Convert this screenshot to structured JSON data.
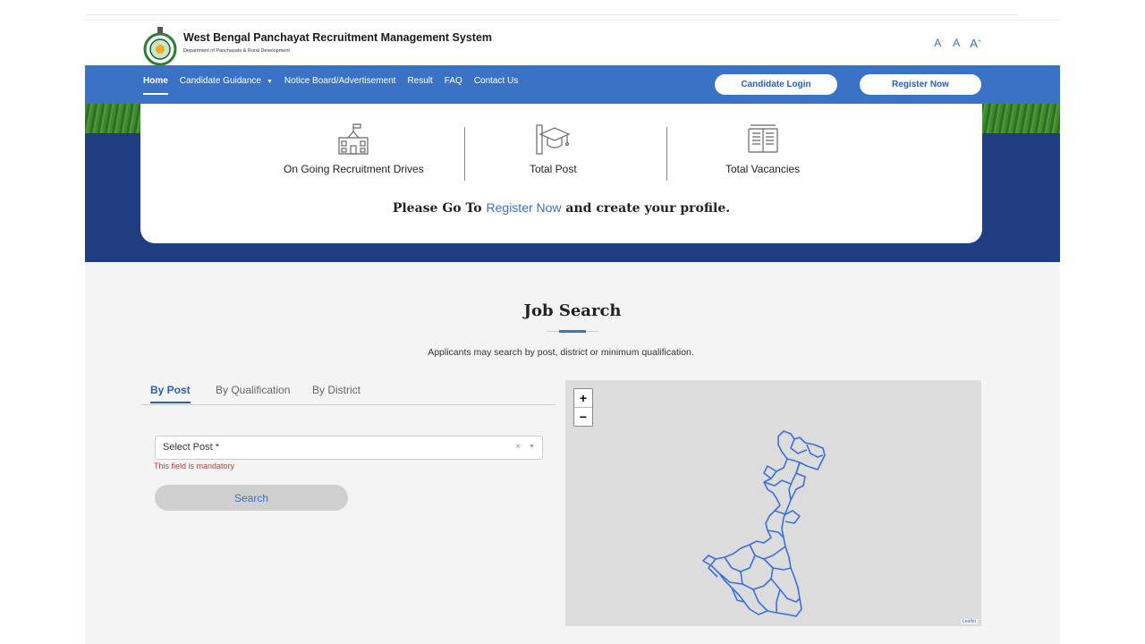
{
  "header": {
    "title": "West Bengal Panchayat Recruitment Management System",
    "subtitle": "Department of Panchayats & Rural Development",
    "font_small": "A",
    "font_normal": "A",
    "font_large": "A",
    "font_small_sup": "-",
    "font_large_sup": "+"
  },
  "nav": {
    "home": "Home",
    "candidate_guidance": "Candidate Guidance",
    "notice_board": "Notice Board/Advertisement",
    "result": "Result",
    "faq": "FAQ",
    "contact": "Contact Us",
    "login": "Candidate Login",
    "register": "Register Now"
  },
  "stats": {
    "drives": "On Going Recruitment Drives",
    "posts": "Total Post",
    "vacancies": "Total Vacancies"
  },
  "cta": {
    "prefix": "Please Go To",
    "link": "Register Now",
    "suffix": "and create your profile."
  },
  "job_search": {
    "title": "Job Search",
    "subtitle": "Applicants may search by post, district or minimum qualification.",
    "tabs": [
      "By Post",
      "By Qualification",
      "By District"
    ],
    "select_placeholder": "Select Post *",
    "clear": "×",
    "error": "This field is mandatory",
    "search_button": "Search"
  },
  "map": {
    "zoom_in": "+",
    "zoom_out": "−",
    "attribution": "Leaflet"
  },
  "colors": {
    "primary": "#3a72c6",
    "hero": "#1f3d80",
    "link": "#3b6fc9",
    "error": "#c0392b"
  }
}
